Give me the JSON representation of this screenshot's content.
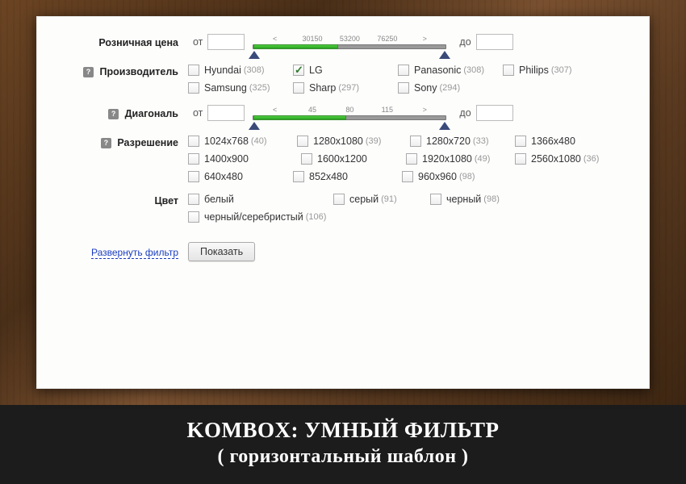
{
  "price": {
    "label": "Розничная цена",
    "from": "от",
    "to": "до",
    "ticks": [
      "<",
      "30150",
      "53200",
      "76250",
      ">"
    ]
  },
  "manufacturer": {
    "label": "Производитель",
    "options": [
      {
        "label": "Hyundai",
        "count": "(308)",
        "checked": false
      },
      {
        "label": "LG",
        "count": "",
        "checked": true
      },
      {
        "label": "Panasonic",
        "count": "(308)",
        "checked": false
      },
      {
        "label": "Philips",
        "count": "(307)",
        "checked": false
      },
      {
        "label": "Samsung",
        "count": "(325)",
        "checked": false
      },
      {
        "label": "Sharp",
        "count": "(297)",
        "checked": false
      },
      {
        "label": "Sony",
        "count": "(294)",
        "checked": false
      }
    ]
  },
  "diagonal": {
    "label": "Диагональ",
    "from": "от",
    "to": "до",
    "ticks": [
      "<",
      "45",
      "80",
      "115",
      ">"
    ]
  },
  "resolution": {
    "label": "Разрешение",
    "options": [
      {
        "label": "1024x768",
        "count": "(40)"
      },
      {
        "label": "1280x1080",
        "count": "(39)"
      },
      {
        "label": "1280x720",
        "count": "(33)"
      },
      {
        "label": "1366x480",
        "count": ""
      },
      {
        "label": "1400x900",
        "count": ""
      },
      {
        "label": "1600x1200",
        "count": ""
      },
      {
        "label": "1920x1080",
        "count": "(49)"
      },
      {
        "label": "2560x1080",
        "count": "(36)"
      },
      {
        "label": "640x480",
        "count": ""
      },
      {
        "label": "852x480",
        "count": ""
      },
      {
        "label": "960x960",
        "count": "(98)"
      }
    ]
  },
  "color": {
    "label": "Цвет",
    "options": [
      {
        "label": "белый",
        "count": ""
      },
      {
        "label": "серый",
        "count": "(91)"
      },
      {
        "label": "черный",
        "count": "(98)"
      },
      {
        "label": "черный/серебристый",
        "count": "(106)"
      }
    ]
  },
  "expand": "Развернуть фильтр",
  "submit": "Показать",
  "footer": {
    "line1": "KOMBOX: УМНЫЙ ФИЛЬТР",
    "line2": "( горизонтальный шаблон )"
  }
}
